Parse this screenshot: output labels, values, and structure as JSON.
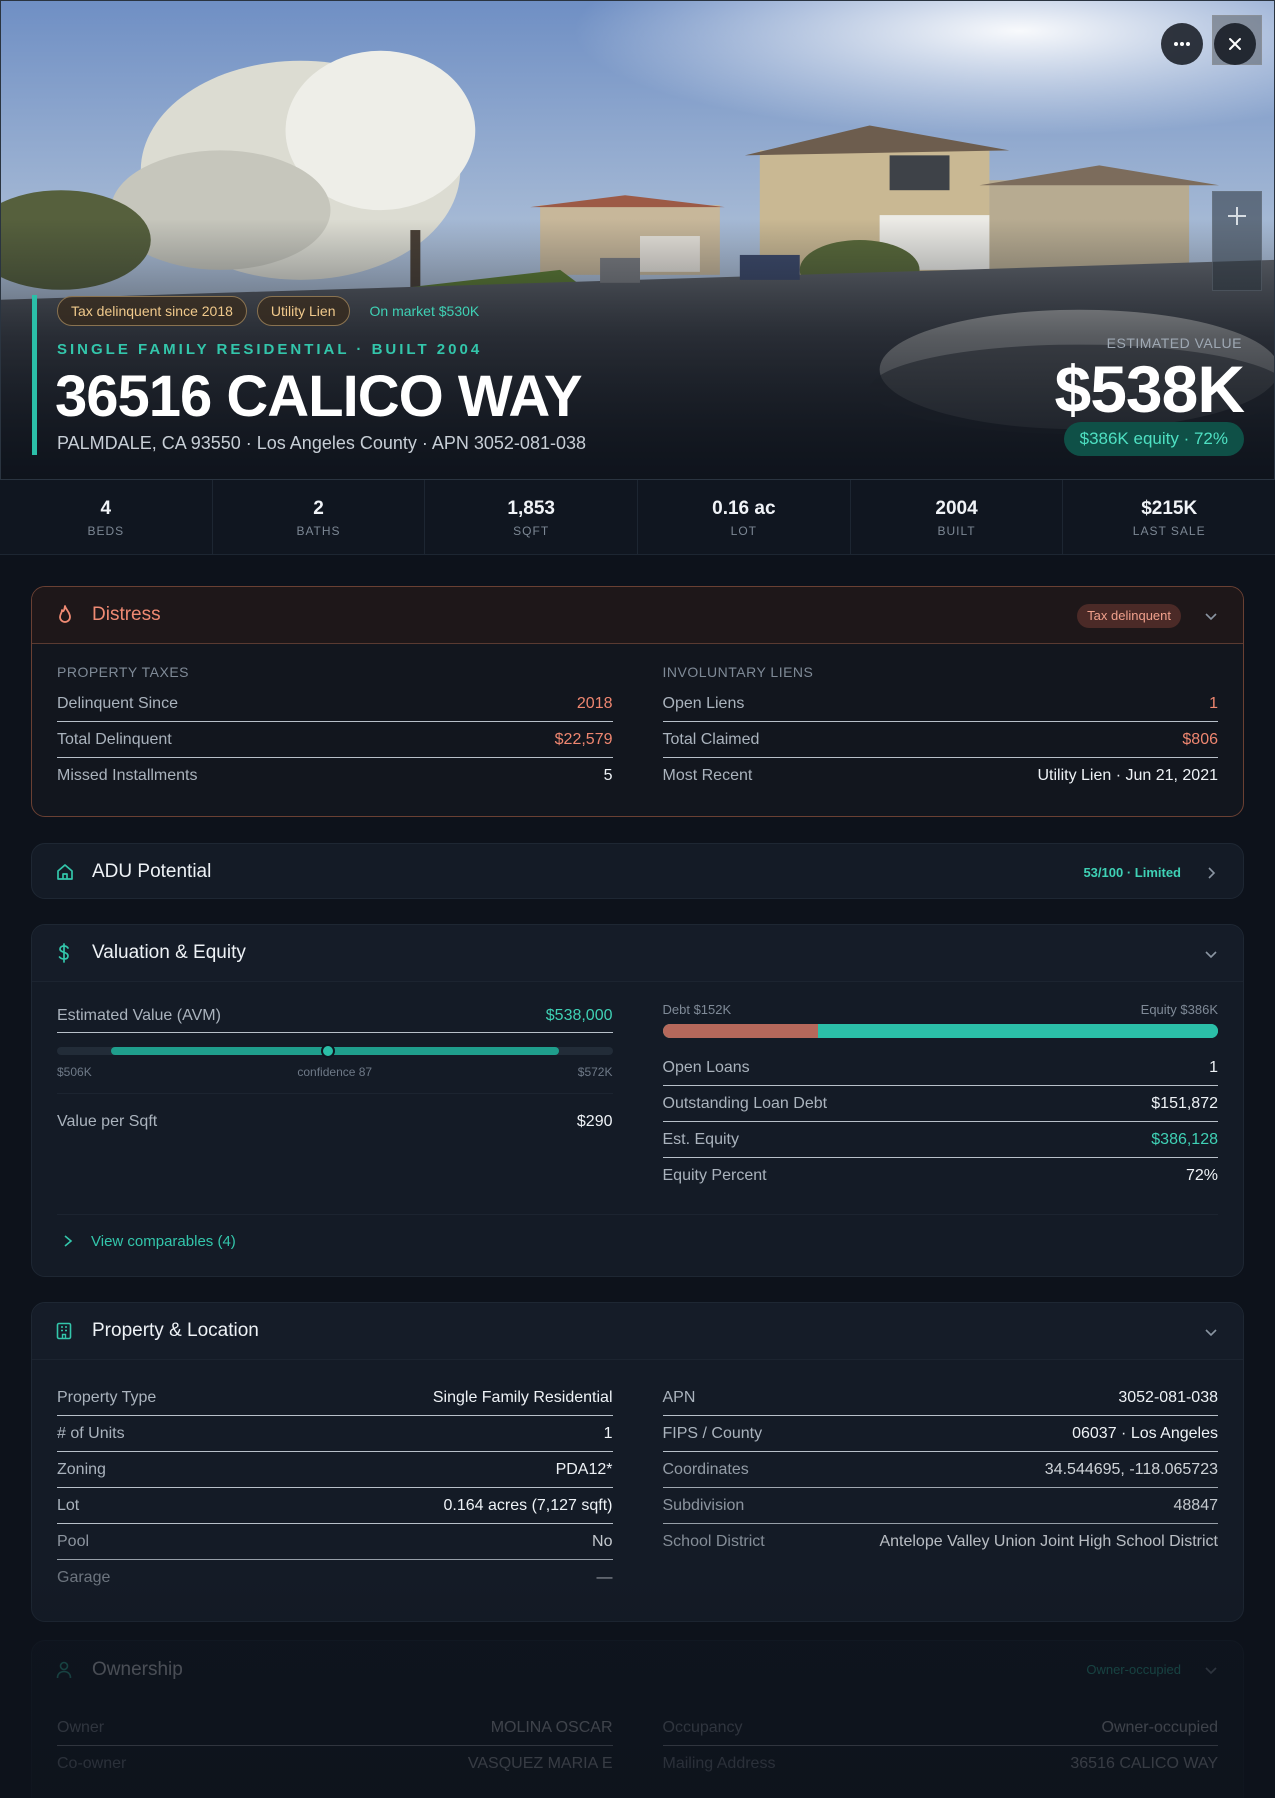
{
  "hero": {
    "chips": [
      "Tax delinquent since 2018",
      "Utility Lien"
    ],
    "market": "On market $530K",
    "eyebrow": "SINGLE FAMILY RESIDENTIAL · BUILT 2004",
    "address": "36516 CALICO WAY",
    "subline": "PALMDALE, CA 93550 · Los Angeles County · APN 3052-081-038",
    "est_label": "ESTIMATED VALUE",
    "est_value": "$538K",
    "equity_pill": "$386K equity · 72%"
  },
  "icons": {
    "more": "more-icon",
    "close": "close-icon",
    "zoom": "plus-icon",
    "distress": "flame-icon",
    "adu": "home-icon",
    "valuation": "dollar-icon",
    "property": "building-icon",
    "ownership": "user-icon"
  },
  "stats": [
    {
      "value": "4",
      "label": "BEDS"
    },
    {
      "value": "2",
      "label": "BATHS"
    },
    {
      "value": "1,853",
      "label": "SQFT"
    },
    {
      "value": "0.16 ac",
      "label": "LOT"
    },
    {
      "value": "2004",
      "label": "BUILT"
    },
    {
      "value": "$215K",
      "label": "LAST SALE"
    }
  ],
  "distress": {
    "title": "Distress",
    "badge": "Tax delinquent",
    "left_label": "PROPERTY TAXES",
    "left": [
      {
        "k": "Delinquent Since",
        "v": "2018"
      },
      {
        "k": "Total Delinquent",
        "v": "$22,579"
      },
      {
        "k": "Missed Installments",
        "v": "5"
      }
    ],
    "right_label": "INVOLUNTARY LIENS",
    "right": [
      {
        "k": "Open Liens",
        "v": "1"
      },
      {
        "k": "Total Claimed",
        "v": "$806"
      },
      {
        "k": "Most Recent",
        "v": "Utility Lien · Jun 21, 2021"
      }
    ]
  },
  "adu": {
    "title": "ADU Potential",
    "score": "53/100 · Limited"
  },
  "valuation": {
    "title": "Valuation & Equity",
    "avm_label": "Estimated Value (AVM)",
    "avm_value": "$538,000",
    "avm_low": "$506K",
    "avm_confidence": "confidence 87",
    "avm_high": "$572K",
    "avm_range": {
      "low": 506,
      "high": 572,
      "value": 538
    },
    "per_sqft_label": "Value per Sqft",
    "per_sqft_value": "$290",
    "debt_label": "Debt $152K",
    "equity_label": "Equity $386K",
    "debt_fraction": 0.28,
    "right": [
      {
        "k": "Open Loans",
        "v": "1"
      },
      {
        "k": "Outstanding Loan Debt",
        "v": "$151,872"
      },
      {
        "k": "Est. Equity",
        "v": "$386,128"
      },
      {
        "k": "Equity Percent",
        "v": "72%"
      }
    ],
    "comps": "View comparables (4)"
  },
  "property": {
    "title": "Property & Location",
    "left": [
      {
        "k": "Property Type",
        "v": "Single Family Residential"
      },
      {
        "k": "# of Units",
        "v": "1"
      },
      {
        "k": "Zoning",
        "v": "PDA12*"
      },
      {
        "k": "Lot",
        "v": "0.164 acres (7,127 sqft)"
      },
      {
        "k": "Pool",
        "v": "No"
      },
      {
        "k": "Garage",
        "v": "—"
      }
    ],
    "right": [
      {
        "k": "APN",
        "v": "3052-081-038"
      },
      {
        "k": "FIPS / County",
        "v": "06037 · Los Angeles"
      },
      {
        "k": "Coordinates",
        "v": "34.544695, -118.065723"
      },
      {
        "k": "Subdivision",
        "v": "48847"
      },
      {
        "k": "School District",
        "v": "Antelope Valley Union Joint High School District"
      }
    ]
  },
  "ownership": {
    "title": "Ownership",
    "badge": "Owner-occupied",
    "left": [
      {
        "k": "Owner",
        "v": "MOLINA OSCAR"
      },
      {
        "k": "Co-owner",
        "v": "VASQUEZ MARIA E"
      }
    ],
    "right": [
      {
        "k": "Occupancy",
        "v": "Owner-occupied"
      },
      {
        "k": "Mailing Address",
        "v": "36516 CALICO WAY"
      }
    ]
  }
}
